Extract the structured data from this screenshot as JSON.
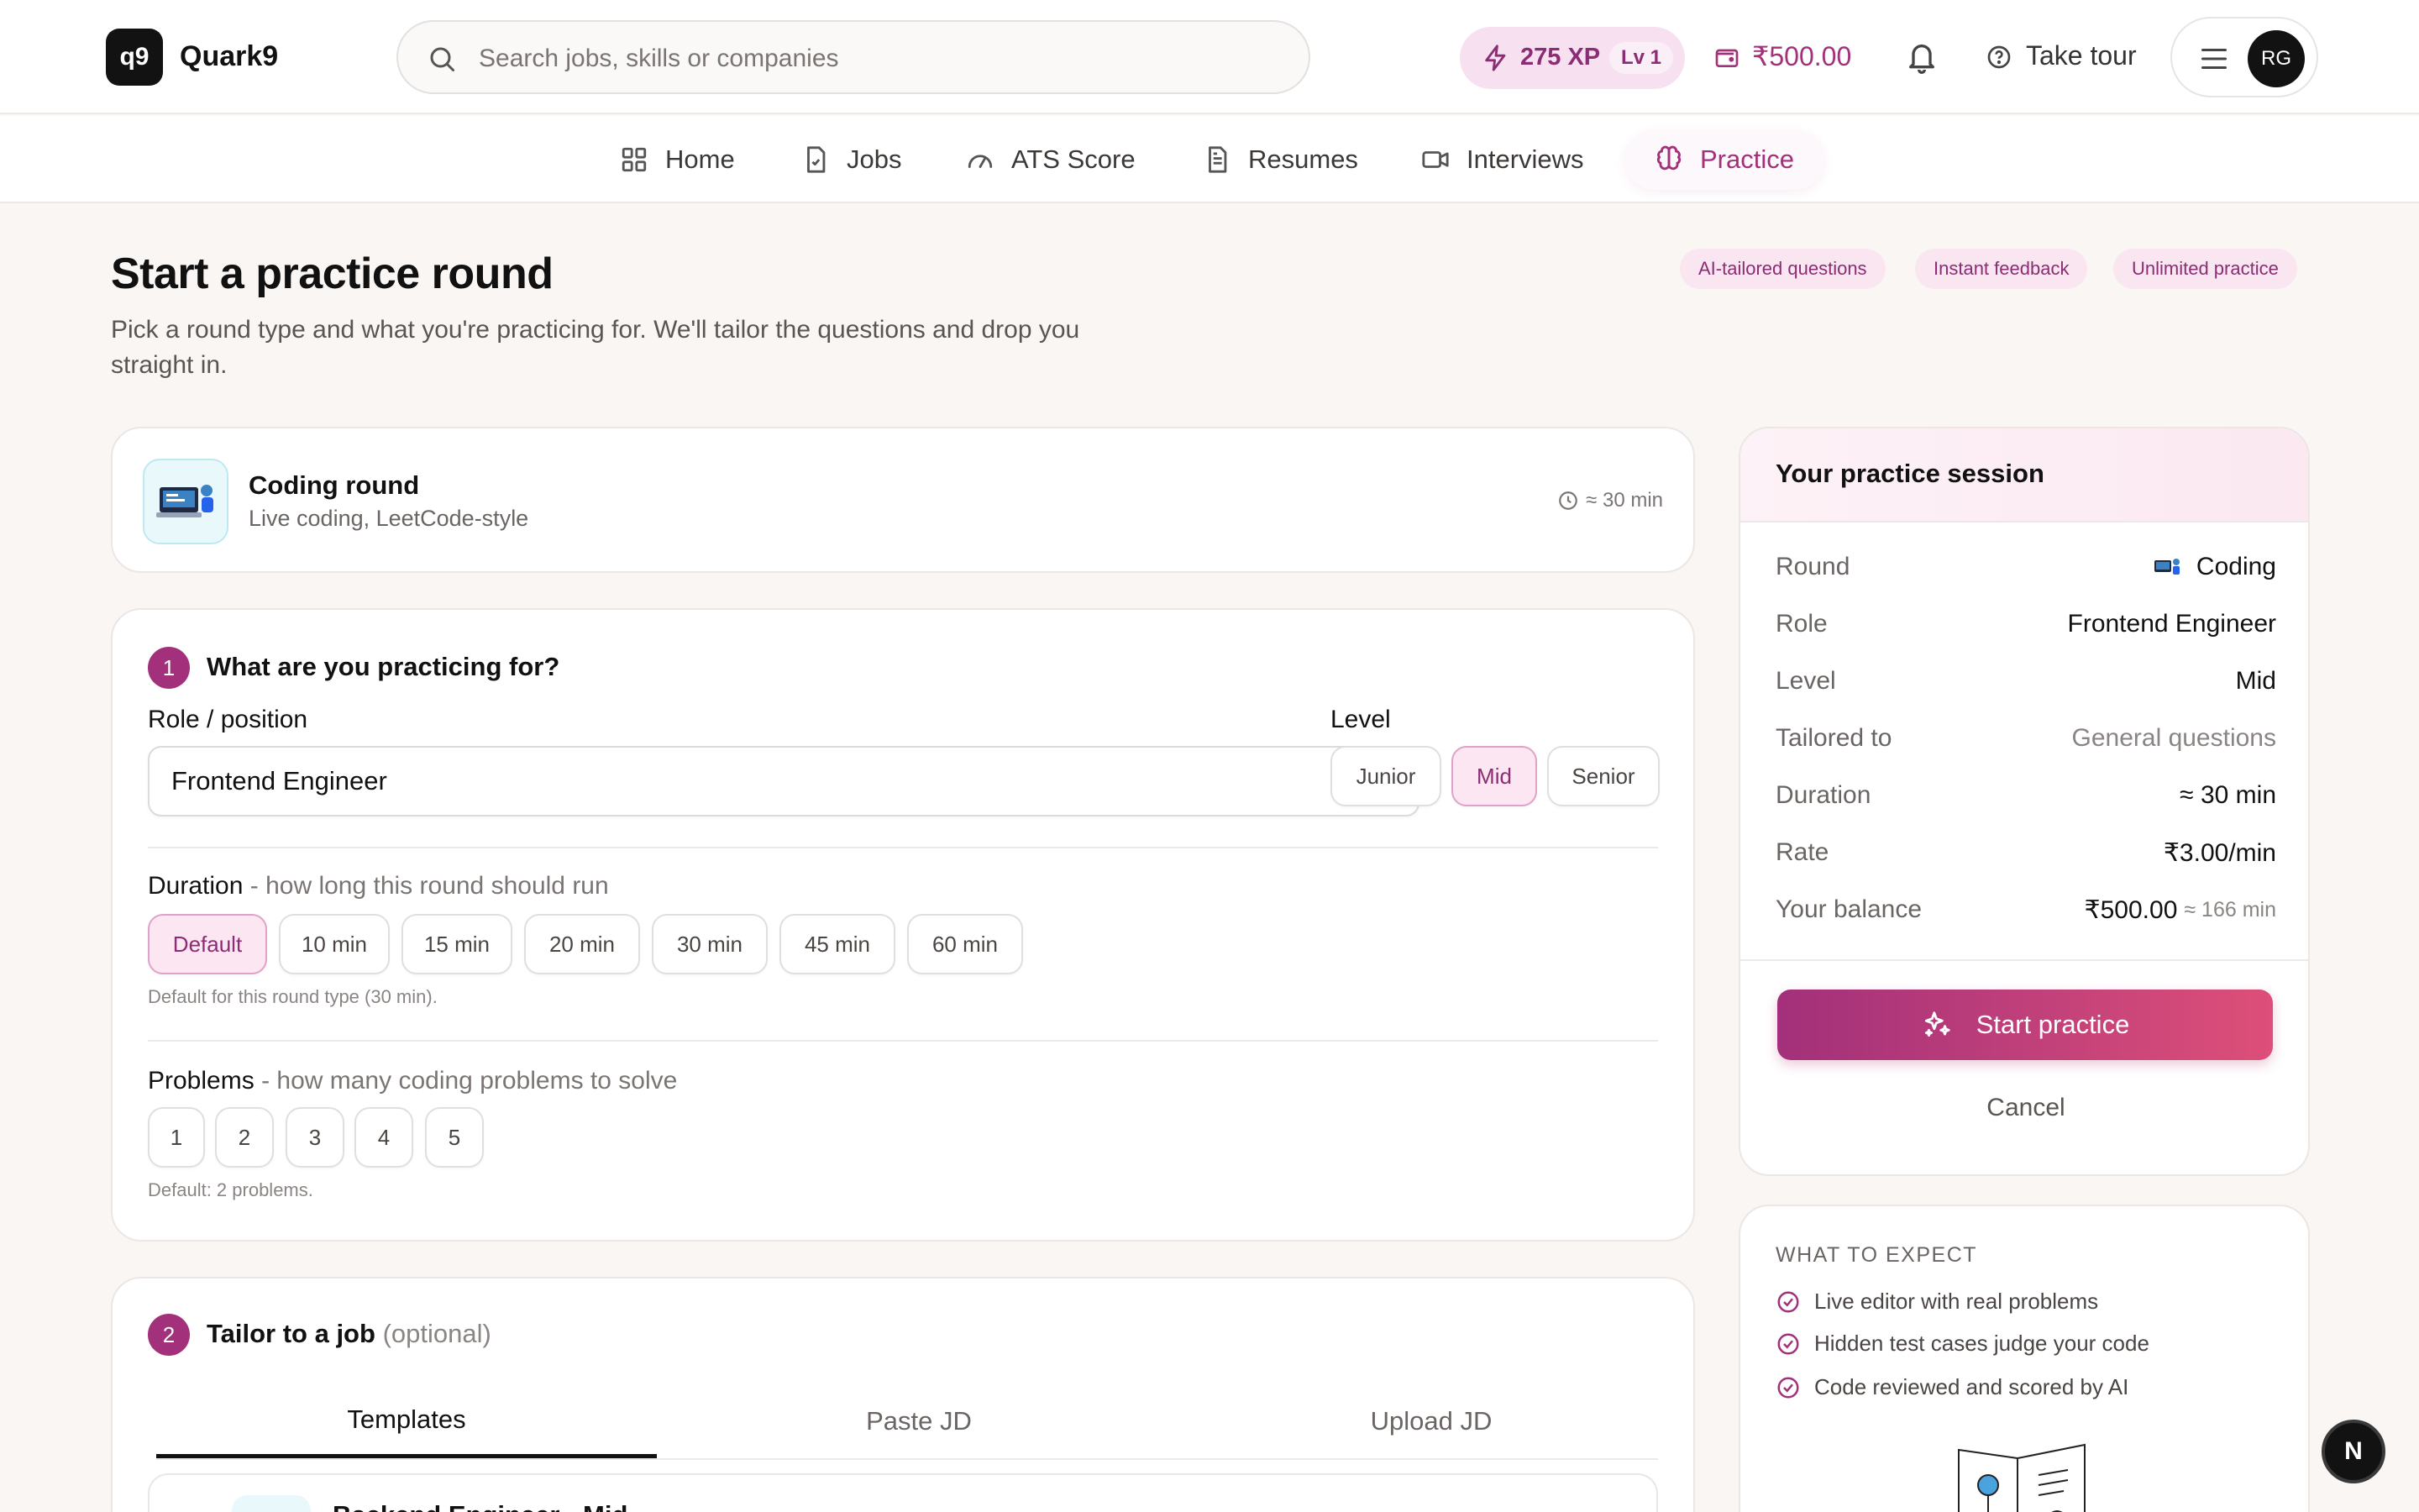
{
  "header": {
    "logo_text": "q9",
    "brand": "Quark9",
    "search_placeholder": "Search jobs, skills or companies",
    "xp": "275 XP",
    "level": "Lv 1",
    "balance": "₹500.00",
    "tour": "Take tour",
    "avatar": "RG"
  },
  "nav": {
    "items": [
      {
        "label": "Home",
        "icon": "grid-icon"
      },
      {
        "label": "Jobs",
        "icon": "file-check-icon"
      },
      {
        "label": "ATS Score",
        "icon": "gauge-icon"
      },
      {
        "label": "Resumes",
        "icon": "document-icon"
      },
      {
        "label": "Interviews",
        "icon": "video-icon"
      },
      {
        "label": "Practice",
        "icon": "brain-icon"
      }
    ],
    "active": "Practice"
  },
  "page": {
    "title": "Start a practice round",
    "subtitle": "Pick a round type and what you're practicing for. We'll tailor the questions and drop you straight in.",
    "badges": [
      "AI-tailored questions",
      "Instant feedback",
      "Unlimited practice"
    ]
  },
  "round": {
    "title": "Coding round",
    "subtitle": "Live coding, LeetCode-style",
    "time": "≈ 30 min"
  },
  "step1": {
    "number": "1",
    "title": "What are you practicing for?",
    "role_label": "Role / position",
    "role_value": "Frontend Engineer",
    "level_label": "Level",
    "levels": [
      "Junior",
      "Mid",
      "Senior"
    ],
    "level_selected": "Mid",
    "duration_label": "Duration",
    "duration_hint": "- how long this round should run",
    "durations": [
      "Default",
      "10 min",
      "15 min",
      "20 min",
      "30 min",
      "45 min",
      "60 min"
    ],
    "duration_selected": "Default",
    "duration_note": "Default for this round type (30 min).",
    "problems_label": "Problems",
    "problems_hint": "- how many coding problems to solve",
    "problems": [
      "1",
      "2",
      "3",
      "4",
      "5"
    ],
    "problems_note": "Default: 2 problems."
  },
  "step2": {
    "number": "2",
    "title": "Tailor to a job",
    "optional": "(optional)",
    "tabs": [
      "Templates",
      "Paste JD",
      "Upload JD"
    ],
    "active_tab": "Templates",
    "template_title": "Backend Engineer · Mid"
  },
  "session": {
    "title": "Your practice session",
    "rows": [
      {
        "k": "Round",
        "v": "Coding"
      },
      {
        "k": "Role",
        "v": "Frontend Engineer"
      },
      {
        "k": "Level",
        "v": "Mid"
      },
      {
        "k": "Tailored to",
        "v": "General questions"
      },
      {
        "k": "Duration",
        "v": "≈ 30 min"
      },
      {
        "k": "Rate",
        "v": "₹3.00/min"
      },
      {
        "k": "Your balance",
        "v": "₹500.00",
        "sub": "≈ 166 min"
      }
    ],
    "start": "Start practice",
    "cancel": "Cancel"
  },
  "expect": {
    "title": "WHAT TO EXPECT",
    "items": [
      "Live editor with real problems",
      "Hidden test cases judge your code",
      "Code reviewed and scored by AI"
    ]
  },
  "fab": "N",
  "colors": {
    "accent": "#a2307a",
    "accent_soft": "#fbe6f2",
    "gradient_end": "#dd4f79",
    "background": "#f9f6f4"
  }
}
